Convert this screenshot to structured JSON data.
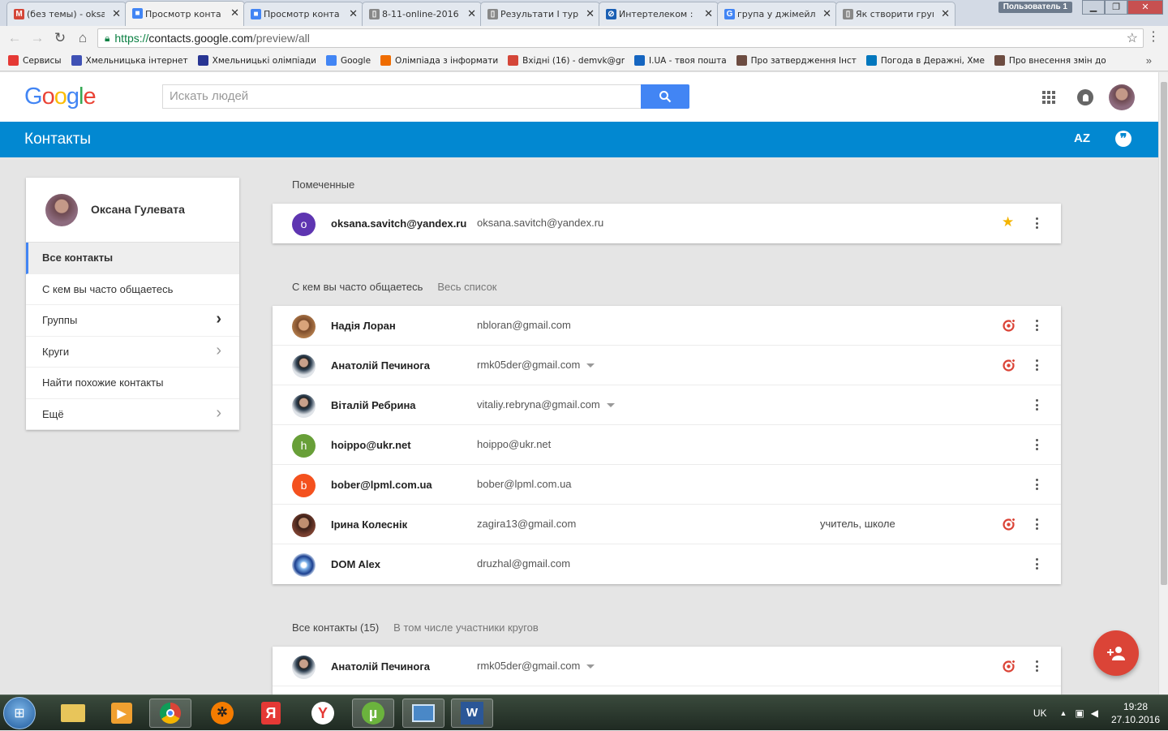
{
  "browser": {
    "tabs": [
      {
        "title": "(без темы) - oksa",
        "favicon": "gmail-icon",
        "color": "#d44638",
        "glyph": "M"
      },
      {
        "title": "Просмотр конта",
        "favicon": "contacts-icon",
        "color": "#4285f4",
        "glyph": "■",
        "active": true
      },
      {
        "title": "Просмотр конта",
        "favicon": "contacts-icon",
        "color": "#4285f4",
        "glyph": "■"
      },
      {
        "title": "8-11-online-2016",
        "favicon": "document-icon",
        "color": "#888888",
        "glyph": "▯"
      },
      {
        "title": "Результати I тур",
        "favicon": "document-icon",
        "color": "#888888",
        "glyph": "▯"
      },
      {
        "title": "Интертелеком :",
        "favicon": "intertelecom-icon",
        "color": "#1a5fb4",
        "glyph": "⊘"
      },
      {
        "title": "група у джімейл",
        "favicon": "google-icon",
        "color": "#4285f4",
        "glyph": "G"
      },
      {
        "title": "Як створити груп",
        "favicon": "document-icon",
        "color": "#888888",
        "glyph": "▯"
      }
    ],
    "user_badge": "Пользователь 1",
    "url": {
      "scheme": "https://",
      "host": "contacts.google.com",
      "path": "/preview/all"
    },
    "bookmarks": [
      {
        "label": "Сервисы",
        "icon": "apps-icon",
        "color": "#e53935"
      },
      {
        "label": "Хмельницька інтернет",
        "icon": "zoi-icon",
        "color": "#3f51b5"
      },
      {
        "label": "Хмельницькі олімпіади",
        "icon": "olympiad-icon",
        "color": "#283593"
      },
      {
        "label": "Google",
        "icon": "google-icon",
        "color": "#4285f4"
      },
      {
        "label": "Олімпіада з інформати",
        "icon": "badge-icon",
        "color": "#ef6c00"
      },
      {
        "label": "Вхідні (16) - demvk@gr",
        "icon": "gmail-icon",
        "color": "#d44638"
      },
      {
        "label": "I.UA - твоя пошта",
        "icon": "iua-icon",
        "color": "#1565c0"
      },
      {
        "label": "Про затвердження Інст",
        "icon": "gov-icon",
        "color": "#6d4c41"
      },
      {
        "label": "Погода в Деражні, Хме",
        "icon": "weather-icon",
        "color": "#0277bd"
      },
      {
        "label": "Про внесення змін до",
        "icon": "gov-icon",
        "color": "#6d4c41"
      }
    ]
  },
  "header": {
    "logo": "Google",
    "search_placeholder": "Искать людей",
    "bar_title": "Контакты",
    "sort_label": "AZ"
  },
  "sidebar": {
    "profile_name": "Оксана Гулевата",
    "items": [
      {
        "label": "Все контакты",
        "active": true,
        "chevron": false
      },
      {
        "label": "С кем вы часто общаетесь",
        "active": false,
        "chevron": false
      },
      {
        "label": "Группы",
        "active": false,
        "chevron": "dark"
      },
      {
        "label": "Круги",
        "active": false,
        "chevron": "light"
      },
      {
        "label": "Найти похожие контакты",
        "active": false,
        "chevron": false
      },
      {
        "label": "Ещё",
        "active": false,
        "chevron": "light"
      }
    ]
  },
  "sections": {
    "starred": {
      "title": "Помеченные",
      "rows": [
        {
          "name": "oksana.savitch@yandex.ru",
          "email": "oksana.savitch@yandex.ru",
          "avatar": "o",
          "avatar_color": "#5e35b1",
          "starred": true
        }
      ]
    },
    "frequent": {
      "title": "С кем вы часто общаетесь",
      "link": "Весь список",
      "rows": [
        {
          "name": "Надія Лоран",
          "email": "nbloran@gmail.com",
          "photo": "photo-woman-glasses",
          "circle": true
        },
        {
          "name": "Анатолій Печинога",
          "email": "rmk05der@gmail.com",
          "photo": "photo-man-suit",
          "circle": true,
          "dropdown": true
        },
        {
          "name": "Віталій Ребрина",
          "email": "vitaliy.rebryna@gmail.com",
          "photo": "photo-man-suit",
          "dropdown": true
        },
        {
          "name": "hoippo@ukr.net",
          "email": "hoippo@ukr.net",
          "avatar": "h",
          "avatar_color": "#689f38"
        },
        {
          "name": "bober@lpml.com.ua",
          "email": "bober@lpml.com.ua",
          "avatar": "b",
          "avatar_color": "#f4511e"
        },
        {
          "name": "Ірина Колеснік",
          "email": "zagira13@gmail.com",
          "photo": "photo-woman-dark",
          "note": "учитель, школе",
          "circle": true
        },
        {
          "name": "DOM Alex",
          "email": "druzhal@gmail.com",
          "photo": "photo-globe"
        }
      ]
    },
    "all": {
      "title": "Все контакты (15)",
      "subtitle": "В том числе участники кругов",
      "rows": [
        {
          "name": "Анатолій Печинога",
          "email": "rmk05der@gmail.com",
          "photo": "photo-man-suit",
          "circle": true,
          "dropdown": true
        }
      ]
    }
  },
  "taskbar": {
    "lang": "UK",
    "time": "19:28",
    "date": "27.10.2016"
  },
  "colors": {
    "brand_blue": "#0288d1",
    "search_blue": "#4285f4",
    "fab_red": "#db4437",
    "circle_red": "#db4437",
    "star_yellow": "#f4b400"
  }
}
